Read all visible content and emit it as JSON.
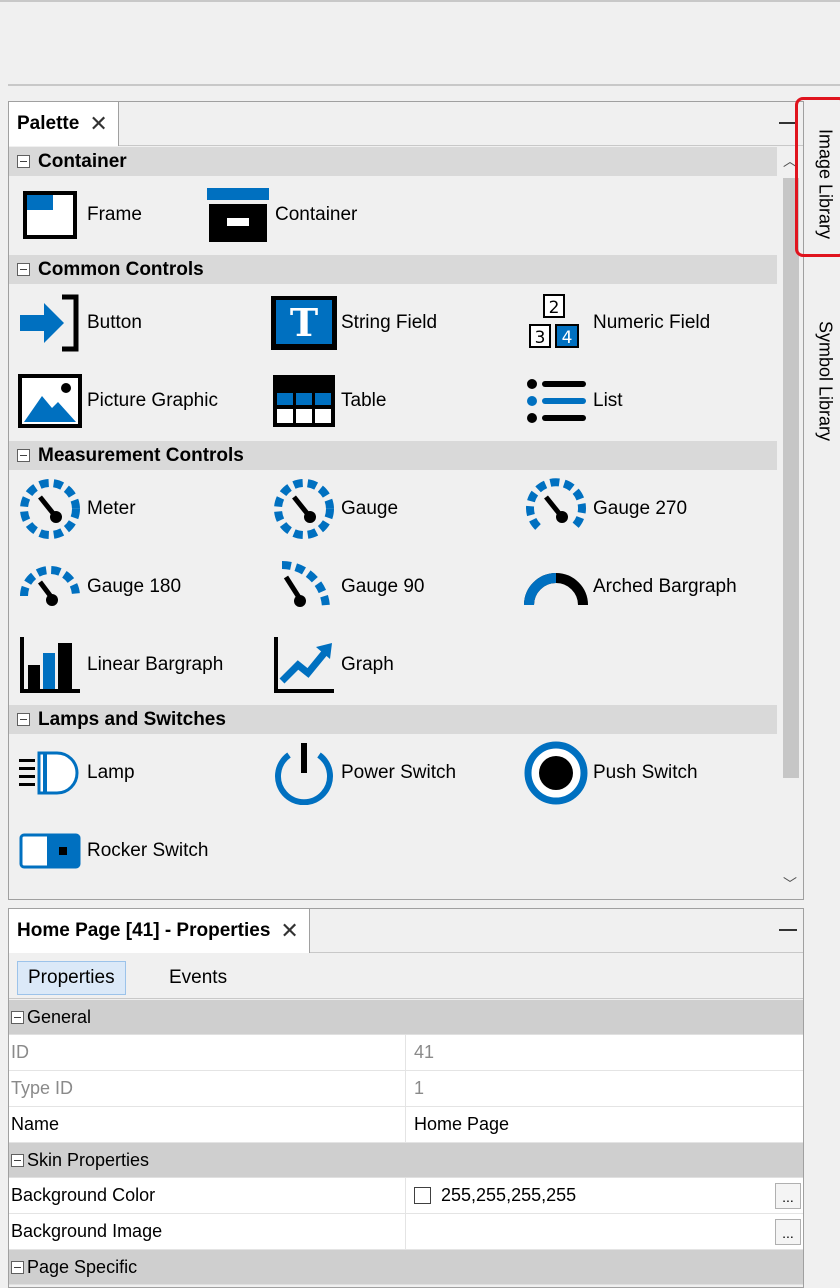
{
  "palette": {
    "title": "Palette",
    "close_glyph": "✕",
    "categories": [
      {
        "label": "Container",
        "items": [
          {
            "label": "Frame",
            "icon": "frame-icon"
          },
          {
            "label": "Container",
            "icon": "container-icon"
          }
        ]
      },
      {
        "label": "Common Controls",
        "items": [
          {
            "label": "Button",
            "icon": "button-arrow-icon"
          },
          {
            "label": "String Field",
            "icon": "string-field-icon"
          },
          {
            "label": "Numeric Field",
            "icon": "numeric-field-icon"
          },
          {
            "label": "Picture Graphic",
            "icon": "picture-graphic-icon"
          },
          {
            "label": "Table",
            "icon": "table-icon"
          },
          {
            "label": "List",
            "icon": "list-icon"
          }
        ]
      },
      {
        "label": "Measurement Controls",
        "items": [
          {
            "label": "Meter",
            "icon": "meter-icon"
          },
          {
            "label": "Gauge",
            "icon": "gauge-icon"
          },
          {
            "label": "Gauge 270",
            "icon": "gauge-270-icon"
          },
          {
            "label": "Gauge 180",
            "icon": "gauge-180-icon"
          },
          {
            "label": "Gauge 90",
            "icon": "gauge-90-icon"
          },
          {
            "label": "Arched Bargraph",
            "icon": "arched-bargraph-icon"
          },
          {
            "label": "Linear Bargraph",
            "icon": "linear-bargraph-icon"
          },
          {
            "label": "Graph",
            "icon": "graph-icon"
          }
        ]
      },
      {
        "label": "Lamps and Switches",
        "items": [
          {
            "label": "Lamp",
            "icon": "lamp-icon"
          },
          {
            "label": "Power Switch",
            "icon": "power-switch-icon"
          },
          {
            "label": "Push Switch",
            "icon": "push-switch-icon"
          },
          {
            "label": "Rocker Switch",
            "icon": "rocker-switch-icon"
          }
        ]
      }
    ],
    "numeric_icon_digits": [
      "2",
      "3",
      "4"
    ],
    "string_icon_letter": "T"
  },
  "side_tabs": [
    "Image Library",
    "Symbol Library"
  ],
  "properties": {
    "title": "Home Page [41] - Properties",
    "close_glyph": "✕",
    "tabs": [
      "Properties",
      "Events"
    ],
    "active_tab": "Properties",
    "sections": [
      {
        "label": "General",
        "rows": [
          {
            "name": "ID",
            "value": "41",
            "readonly": true
          },
          {
            "name": "Type ID",
            "value": "1",
            "readonly": true
          },
          {
            "name": "Name",
            "value": "Home Page",
            "readonly": false
          }
        ]
      },
      {
        "label": "Skin Properties",
        "rows": [
          {
            "name": "Background Color",
            "value": "255,255,255,255",
            "readonly": false
          },
          {
            "name": "Background Image",
            "value": "",
            "readonly": false
          }
        ]
      },
      {
        "label": "Page Specific",
        "rows": []
      }
    ],
    "ellipsis": "..."
  },
  "colors": {
    "accent_blue": "#0070c0",
    "icon_dark": "#000000",
    "highlight_red": "#e0141e"
  }
}
